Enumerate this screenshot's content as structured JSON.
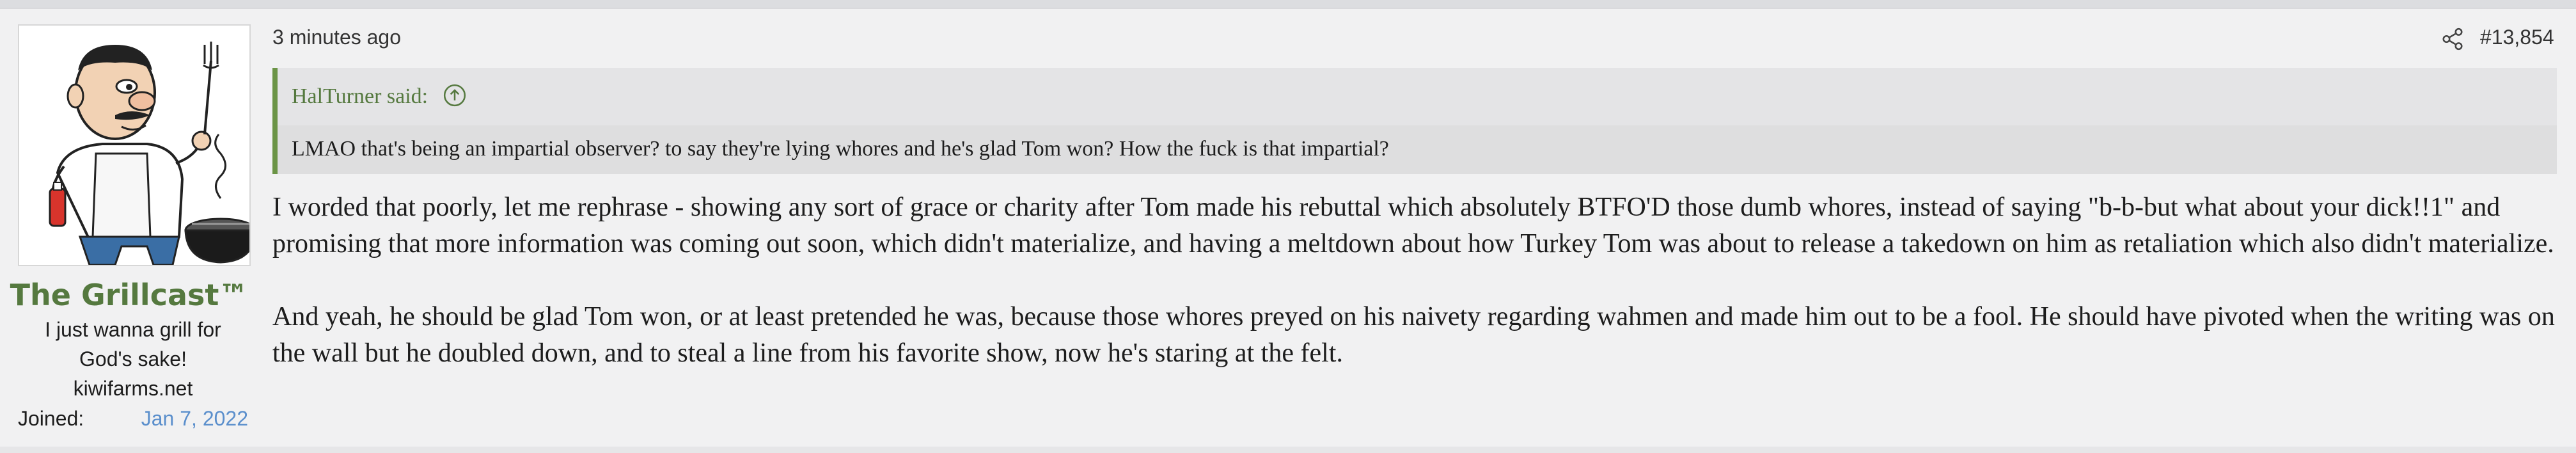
{
  "user": {
    "avatar_icon": "grill-man-avatar",
    "name": "The Grillcast™",
    "title": "I just wanna grill for God's sake! kiwifarms.net",
    "joined_label": "Joined:",
    "joined_date": "Jan 7, 2022",
    "name_color": "#55793f"
  },
  "post": {
    "timestamp": "3 minutes ago",
    "share_icon": "share-icon",
    "number": "#13,854",
    "quote": {
      "attribution": "HalTurner said:",
      "jump_icon": "arrow-up-circle-icon",
      "text": "LMAO that's being an impartial observer? to say they're lying whores and he's glad Tom won? How the fuck is that impartial?"
    },
    "paragraphs": [
      "I worded that poorly, let me rephrase - showing any sort of grace or charity after Tom made his rebuttal which absolutely BTFO'D those dumb whores, instead of saying \"b-b-but what about your dick!!1\" and promising that more information was coming out soon, which didn't materialize, and having a meltdown about how Turkey Tom was about to release a takedown on him as retaliation which also didn't materialize.",
      "And yeah, he should be glad Tom won, or at least pretended he was, because those whores preyed on his naivety regarding wahmen and made him out to be a fool. He should have pivoted when the writing was on the wall but he doubled down, and to steal a line from his favorite show, now he's staring at the felt."
    ]
  }
}
